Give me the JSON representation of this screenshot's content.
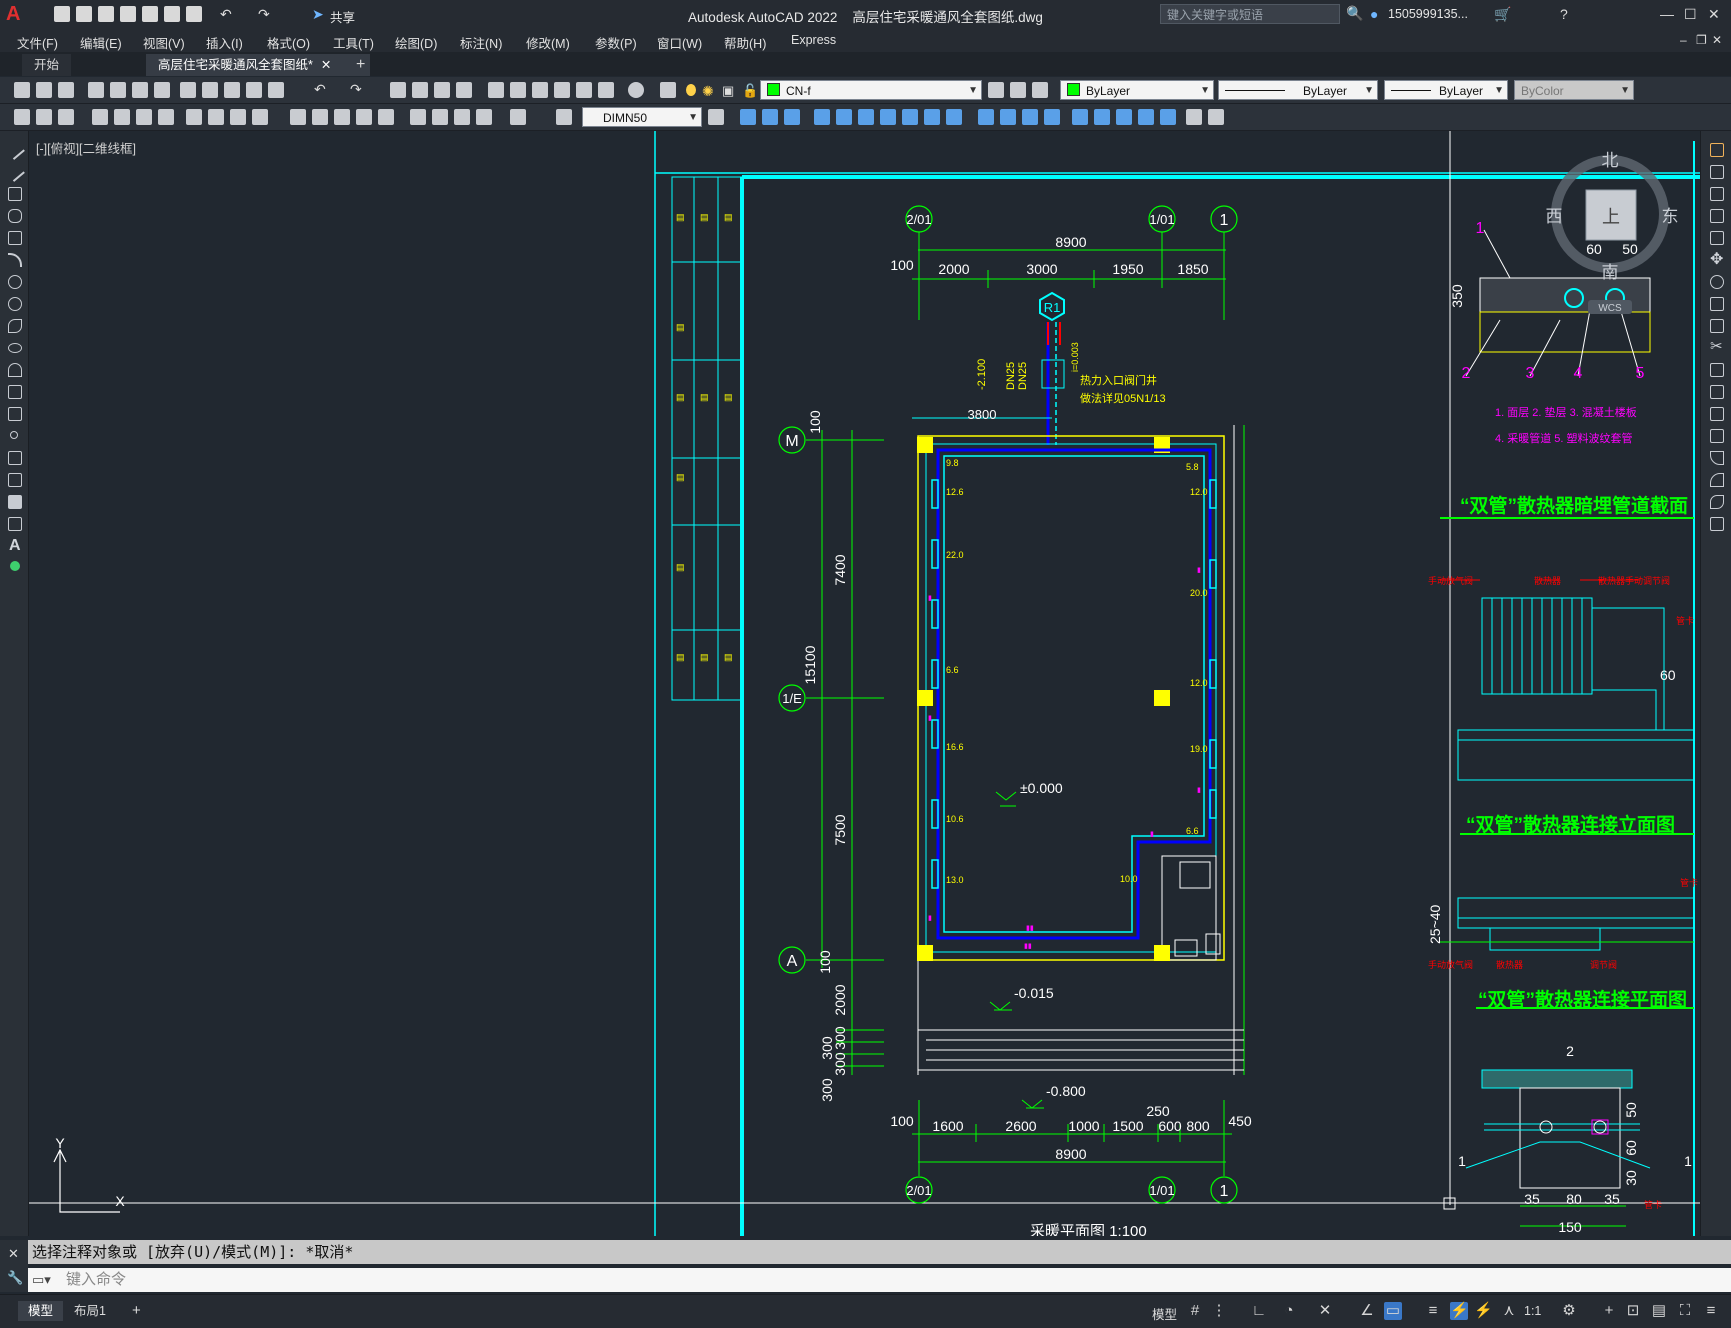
{
  "title_bar": {
    "app_name": "Autodesk AutoCAD 2022",
    "file_name": "高层住宅采暖通风全套图纸.dwg",
    "share_label": "共享",
    "search_placeholder": "键入关键字或短语",
    "user": "1505999135...",
    "icons": [
      "new-icon",
      "open-icon",
      "save-icon",
      "saveas-icon",
      "open-web-icon",
      "save-web-icon",
      "plot-icon",
      "undo-icon",
      "redo-icon",
      "share-icon",
      "user-icon",
      "cart-icon",
      "help-icon"
    ]
  },
  "menu": [
    "文件(F)",
    "编辑(E)",
    "视图(V)",
    "插入(I)",
    "格式(O)",
    "工具(T)",
    "绘图(D)",
    "标注(N)",
    "修改(M)",
    "参数(P)",
    "窗口(W)",
    "帮助(H)",
    "Express"
  ],
  "tabs": [
    {
      "label": "开始"
    },
    {
      "label": "高层住宅采暖通风全套图纸*"
    }
  ],
  "toolbar": {
    "layer_name": "CN-f",
    "color": "ByLayer",
    "linetype": "ByLayer",
    "lineweight": "ByLayer",
    "plotstyle": "ByColor",
    "dimstyle": "DIMN50"
  },
  "viewport_label": "[-][俯视][二维线框]",
  "viewcube": {
    "north": "北",
    "south": "南",
    "east": "东",
    "west": "西",
    "top": "上",
    "wcs": "WCS"
  },
  "drawing": {
    "grid_labels": {
      "col1": "2/01",
      "col2": "1/01",
      "col3": "1",
      "row_m": "M",
      "row_e": "1/E",
      "row_a": "A",
      "heat_in": "R1"
    },
    "top_dims": {
      "total": "8900",
      "seg": [
        "100",
        "2000",
        "3000",
        "1950",
        "1850"
      ]
    },
    "bottom_dims": {
      "total": "8900",
      "seg": [
        "100",
        "1600",
        "2600",
        "1000",
        "1500",
        "600",
        "800",
        "450"
      ],
      "extra": "250"
    },
    "left_dims": {
      "total": "15100",
      "upper": "7400",
      "lower": "7500",
      "top_gap": "100",
      "bot_gap": "100",
      "below": [
        "2000",
        "300",
        "300",
        "300",
        "300"
      ]
    },
    "pipe_notes": {
      "elev": "-2.100",
      "dn1": "DN25",
      "dn2": "DN25",
      "slope": "i=0.003",
      "note1": "热力入口阀门井",
      "note2": "做法详见05N1/13",
      "dist": "3800"
    },
    "levels": [
      "±0.000",
      "-0.015",
      "-0.800"
    ],
    "room_values": [
      "9.8",
      "12.6",
      "12.6",
      "22.0",
      "6.6",
      "16.6",
      "10.6",
      "13.0",
      "5.8",
      "12.0",
      "20.0",
      "12.0",
      "19.0",
      "6.6",
      "10.0"
    ],
    "plan_title": "采暖平面图",
    "plan_scale": "1:100"
  },
  "details": {
    "d1_dims": [
      "60",
      "50",
      "350"
    ],
    "d1_numbers": [
      "1",
      "2",
      "3",
      "4",
      "5"
    ],
    "d1_legend1": "1. 面层  2. 垫层  3. 混凝土楼板",
    "d1_legend2": "4. 采暖管道  5. 塑料波纹套管",
    "title1": "“双管”散热器暗埋管道截面",
    "labels_a": [
      "手动放气阀",
      "散热器",
      "散热器手动调节阀",
      "管卡",
      "60"
    ],
    "title2": "“双管”散热器连接立面图",
    "dim_b": "25~40",
    "labels_b": [
      "管卡",
      "手动放气阀",
      "散热器",
      "散热器手动调节阀",
      "调节阀"
    ],
    "title3": "“双管”散热器连接平面图",
    "d3_dims": [
      "2",
      "50",
      "60",
      "30",
      "1",
      "1",
      "35",
      "80",
      "35",
      "150"
    ],
    "d3_note": "管卡"
  },
  "command": {
    "history": "选择注释对象或 [放弃(U)/模式(M)]: *取消*",
    "placeholder": "键入命令"
  },
  "status": {
    "tabs": [
      "模型",
      "布局1"
    ],
    "model_label": "模型",
    "scale": "1:1"
  },
  "colors": {
    "cyan": "#00ffff",
    "green": "#00ff00",
    "yellow": "#ffff00",
    "blue": "#0000ff",
    "magenta": "#ff00ff",
    "red": "#ff0000",
    "white": "#ffffff",
    "background": "#212830"
  }
}
